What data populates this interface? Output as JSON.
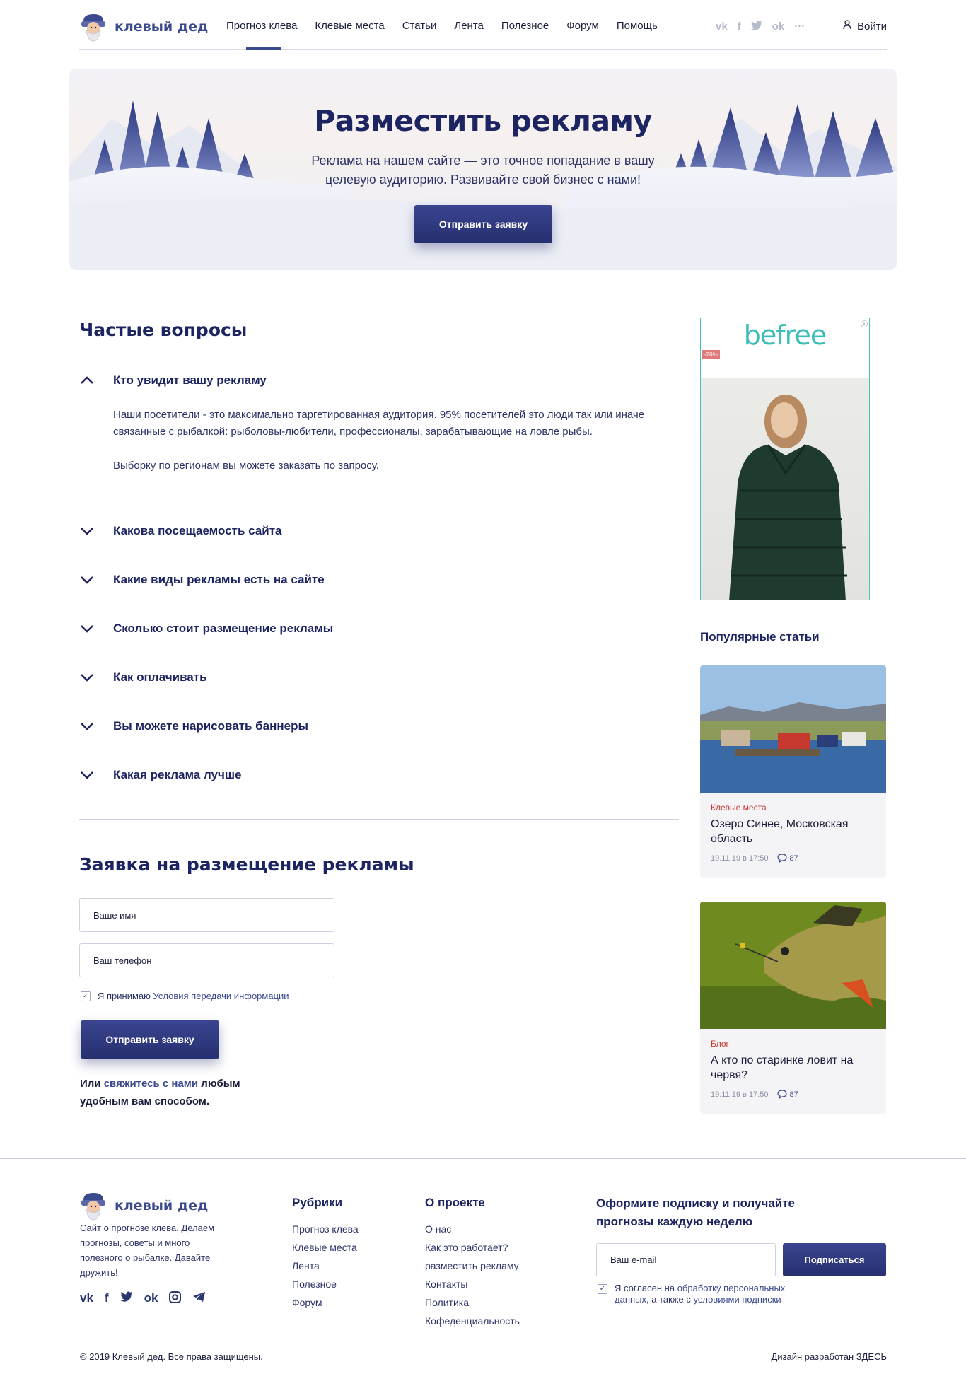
{
  "header": {
    "logo_text": "клевый дед",
    "nav": [
      "Прогноз клева",
      "Клевые места",
      "Статьи",
      "Лента",
      "Полезное",
      "Форум",
      "Помощь"
    ],
    "active_nav": "Прогноз клева",
    "social_icons": [
      "vk-icon",
      "facebook-icon",
      "twitter-icon",
      "odnoklassniki-icon",
      "more-icon"
    ],
    "login_label": "Войти"
  },
  "hero": {
    "title": "Разместить рекламу",
    "text": "Реклама на нашем сайте — это точное попадание в вашу целевую аудиторию. Развивайте свой бизнес с нами!",
    "button": "Отправить заявку"
  },
  "faq": {
    "title": "Частые вопросы",
    "items": [
      {
        "q": "Кто увидит вашу рекламу",
        "expanded": true
      },
      {
        "q": "Какова посещаемость сайта",
        "expanded": false
      },
      {
        "q": "Какие виды рекламы есть на сайте",
        "expanded": false
      },
      {
        "q": "Сколько стоит размещение рекламы",
        "expanded": false
      },
      {
        "q": "Как оплачивать",
        "expanded": false
      },
      {
        "q": "Вы можете нарисовать баннеры",
        "expanded": false
      },
      {
        "q": "Какая реклама лучше",
        "expanded": false
      }
    ],
    "answer_p1": "Наши посетители - это максимально таргетированная аудитория. 95% посетителей это люди так или иначе связанные с рыбалкой: рыболовы-любители, профессионалы, зарабатывающие на ловле рыбы.",
    "answer_p2": "Выборку по регионам вы можете заказать по запросу."
  },
  "form": {
    "title": "Заявка на размещение рекламы",
    "name_placeholder": "Ваше имя",
    "phone_placeholder": "Ваш телефон",
    "consent_prefix": "Я принимаю ",
    "consent_link": "Условия передачи информации",
    "button": "Отправить заявку",
    "note_prefix": "Или ",
    "note_link": "свяжитесь с нами",
    "note_suffix": " любым удобным вам способом."
  },
  "ad": {
    "brand": "befree",
    "badge": "-20%",
    "info": "ⓘ"
  },
  "popular": {
    "title": "Популярные статьи",
    "cards": [
      {
        "category": "Клевые места",
        "title": "Озеро Синее, Московская область",
        "date": "19.11.19 в 17:50",
        "comments": "87"
      },
      {
        "category": "Блог",
        "title": "А кто по старинке ловит на червя?",
        "date": "19.11.19 в 17:50",
        "comments": "87"
      }
    ]
  },
  "footer": {
    "logo_text": "клевый дед",
    "description": "Сайт о прогнозе клева. Делаем прогнозы, советы и много полезного о рыбалке. Давайте дружить!",
    "social_icons": [
      "vk-icon",
      "facebook-icon",
      "twitter-icon",
      "odnoklassniki-icon",
      "instagram-icon",
      "telegram-icon"
    ],
    "col1_title": "Рубрики",
    "col1_items": [
      "Прогноз клева",
      "Клевые места",
      "Лента",
      "Полезное",
      "Форум"
    ],
    "col2_title": "О проекте",
    "col2_items": [
      "О нас",
      "Как это работает?",
      "разместить рекламу",
      "Контакты",
      "Политика",
      "Кофеденциальность"
    ],
    "subscribe_title": "Оформите подписку и получайте прогнозы каждую неделю",
    "email_placeholder": "Ваш e-mail",
    "subscribe_button": "Подписаться",
    "consent_prefix": "Я согласен на ",
    "consent_link1": "обработку персональных данных",
    "consent_mid": ", а также с ",
    "consent_link2": "условиями подписки",
    "copyright": "© 2019 Клевый дед. Все права защищены.",
    "designed": "Дизайн разработан ЗДЕСЬ"
  },
  "colors": {
    "brand": "#1c2461",
    "accent": "#3b4a8e",
    "category": "#c7382f",
    "ad_border": "#46c2bd"
  }
}
